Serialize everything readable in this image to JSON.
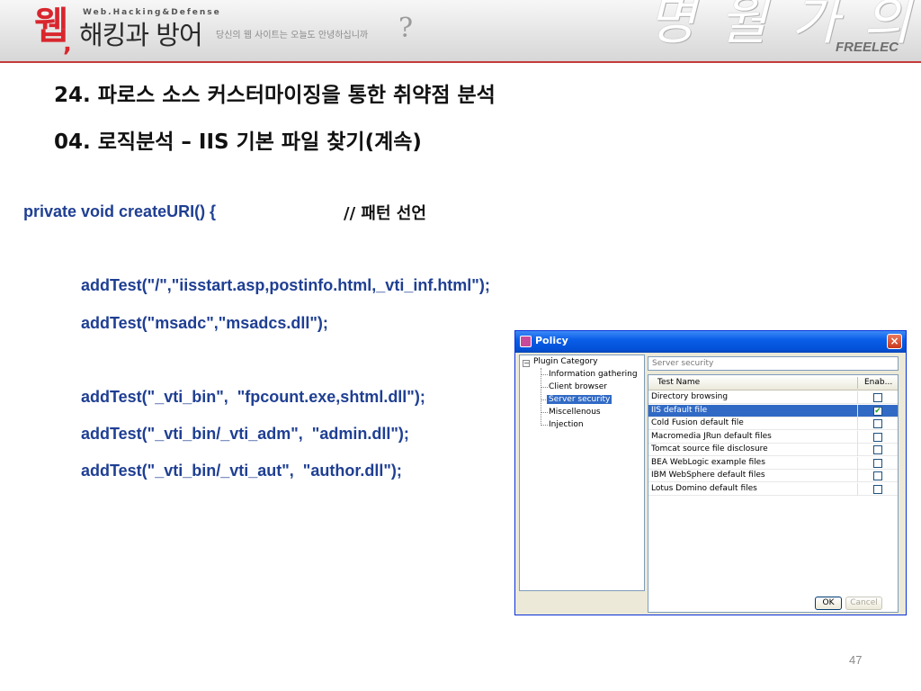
{
  "header": {
    "logo_main": "웹",
    "logo_comma": ",",
    "logo_subtitle": "Web.Hacking&Defense",
    "logo_title": "해킹과 방어",
    "tagline": "당신의 웹 사이트는 오늘도 안녕하십니까",
    "tagline_mark": "?",
    "script_decoration": "명 월 가 의",
    "publisher": "FREELEC"
  },
  "slide": {
    "heading1": "24. 파로스 소스 커스터마이징을 통한 취약점 분석",
    "heading2": "04. 로직분석 – IIS 기본 파일 찾기(계속)",
    "code_declaration": "private void createURI() {",
    "code_comment": "// 패턴 선언",
    "code_lines": [
      "addTest(\"/\",\"iisstart.asp,postinfo.html,_vti_inf.html\");",
      "addTest(\"msadc\",\"msadcs.dll\");",
      "addTest(\"_vti_bin\",  \"fpcount.exe,shtml.dll\");",
      "addTest(\"_vti_bin/_vti_adm\",  \"admin.dll\");",
      "addTest(\"_vti_bin/_vti_aut\",  \"author.dll\");"
    ],
    "page_number": "47"
  },
  "policy_window": {
    "title": "Policy",
    "close_glyph": "×",
    "tree": {
      "expander_glyph": "−",
      "root": "Plugin Category",
      "items": [
        "Information gathering",
        "Client browser",
        "Server security",
        "Miscellenous",
        "Injection"
      ],
      "selected_item": "Server security"
    },
    "category_field_value": "Server security",
    "table": {
      "col_name": "Test Name",
      "col_enable": "Enab...",
      "rows": [
        {
          "name": "Directory browsing",
          "enabled": false
        },
        {
          "name": "IIS default file",
          "enabled": true,
          "selected": true
        },
        {
          "name": "Cold Fusion default file",
          "enabled": false
        },
        {
          "name": "Macromedia JRun default files",
          "enabled": false
        },
        {
          "name": "Tomcat source file disclosure",
          "enabled": false
        },
        {
          "name": "BEA WebLogic example files",
          "enabled": false
        },
        {
          "name": "IBM WebSphere default files",
          "enabled": false
        },
        {
          "name": "Lotus Domino default files",
          "enabled": false
        }
      ]
    },
    "ok_label": "OK",
    "cancel_label": "Cancel"
  }
}
